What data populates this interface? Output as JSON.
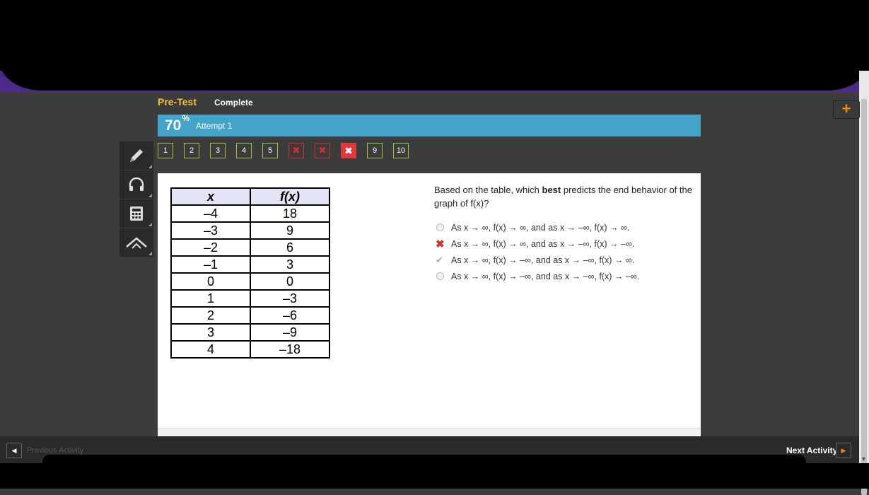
{
  "header": {
    "title": "Pre-Test",
    "status": "Complete"
  },
  "score": {
    "value": "70",
    "unit": "%",
    "attempt": "Attempt 1"
  },
  "plus_button": {
    "label": "+"
  },
  "question_nav": [
    {
      "label": "1",
      "state": "normal"
    },
    {
      "label": "2",
      "state": "normal"
    },
    {
      "label": "3",
      "state": "normal"
    },
    {
      "label": "4",
      "state": "normal"
    },
    {
      "label": "5",
      "state": "normal"
    },
    {
      "label": "✖",
      "state": "wrong"
    },
    {
      "label": "✖",
      "state": "wrong"
    },
    {
      "label": "✖",
      "state": "current"
    },
    {
      "label": "9",
      "state": "normal"
    },
    {
      "label": "10",
      "state": "normal"
    }
  ],
  "tools": [
    "pencil-icon",
    "headphones-icon",
    "calculator-icon",
    "collapse-icon"
  ],
  "table": {
    "headers": [
      "x",
      "f(x)"
    ],
    "rows": [
      [
        "–4",
        "18"
      ],
      [
        "–3",
        "9"
      ],
      [
        "–2",
        "6"
      ],
      [
        "–1",
        "3"
      ],
      [
        "0",
        "0"
      ],
      [
        "1",
        "–3"
      ],
      [
        "2",
        "–6"
      ],
      [
        "3",
        "–9"
      ],
      [
        "4",
        "–18"
      ]
    ]
  },
  "question": {
    "pre": "Based on the table, which ",
    "bold": "best",
    "post": " predicts the end behavior of the graph of f(x)?"
  },
  "options": [
    {
      "text": "As x → ∞, f(x) → ∞, and as x → –∞, f(x) → ∞.",
      "state": "unselected"
    },
    {
      "text": "As x → ∞, f(x) → ∞, and as x → –∞, f(x) → –∞.",
      "state": "incorrect"
    },
    {
      "text": "As x → ∞, f(x) → –∞, and as x → –∞, f(x) → ∞.",
      "state": "correct"
    },
    {
      "text": "As x → ∞, f(x) → –∞, and as x → –∞, f(x) → –∞.",
      "state": "unselected"
    }
  ],
  "footer": {
    "prev_label": "Previous Activity",
    "next_label": "Next Activity"
  },
  "colors": {
    "accent": "#43a3c9",
    "title": "#f0c33c",
    "wrong": "#d32f2f",
    "nav_border": "#a9c23a"
  }
}
